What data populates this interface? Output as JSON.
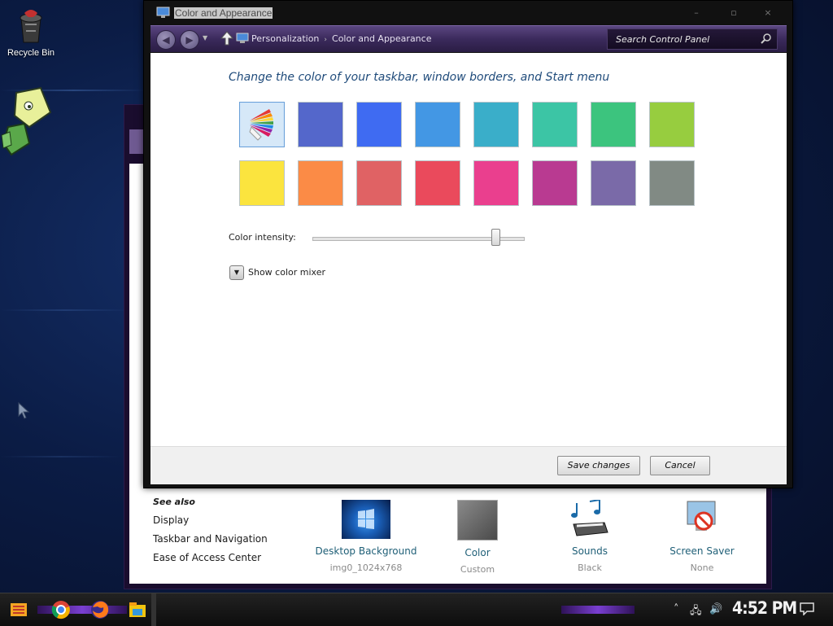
{
  "desktop": {
    "recycle_bin_label": "Recycle Bin"
  },
  "window": {
    "title": "Color and Appearance",
    "controls": {
      "minimize": "–",
      "maximize": "▫",
      "close": "×"
    }
  },
  "nav": {
    "breadcrumb": [
      "Personalization",
      "Color and Appearance"
    ],
    "search_placeholder": "Search Control Panel"
  },
  "content": {
    "heading": "Change the color of your taskbar, window borders, and Start menu",
    "swatches": [
      {
        "name": "auto",
        "color": "#d6e8f8",
        "selected": true
      },
      {
        "name": "slate-blue",
        "color": "#5467cb"
      },
      {
        "name": "blue",
        "color": "#3f6bf2"
      },
      {
        "name": "sky-blue",
        "color": "#4397e4"
      },
      {
        "name": "teal",
        "color": "#3aaec9"
      },
      {
        "name": "aqua-green",
        "color": "#3cc5a5"
      },
      {
        "name": "green",
        "color": "#3cc47e"
      },
      {
        "name": "lime",
        "color": "#97cd3f"
      },
      {
        "name": "yellow",
        "color": "#fbe43e"
      },
      {
        "name": "orange",
        "color": "#fb8b46"
      },
      {
        "name": "salmon",
        "color": "#e06264"
      },
      {
        "name": "red",
        "color": "#ea4a5c"
      },
      {
        "name": "pink",
        "color": "#ea3f8e"
      },
      {
        "name": "magenta",
        "color": "#b93a91"
      },
      {
        "name": "lavender",
        "color": "#7a6aa8"
      },
      {
        "name": "gray",
        "color": "#818a84"
      }
    ],
    "intensity_label": "Color intensity:",
    "intensity_value": 0.87,
    "mixer_label": "Show color mixer"
  },
  "footer": {
    "save_label": "Save changes",
    "cancel_label": "Cancel"
  },
  "background_window": {
    "see_also_header": "See also",
    "see_also_links": [
      "Display",
      "Taskbar and Navigation",
      "Ease of Access Center"
    ],
    "items": [
      {
        "name": "Desktop Background",
        "sub": "img0_1024x768"
      },
      {
        "name": "Color",
        "sub": "Custom"
      },
      {
        "name": "Sounds",
        "sub": "Black"
      },
      {
        "name": "Screen Saver",
        "sub": "None"
      }
    ]
  },
  "taskbar": {
    "clock": "4:52 PM"
  }
}
